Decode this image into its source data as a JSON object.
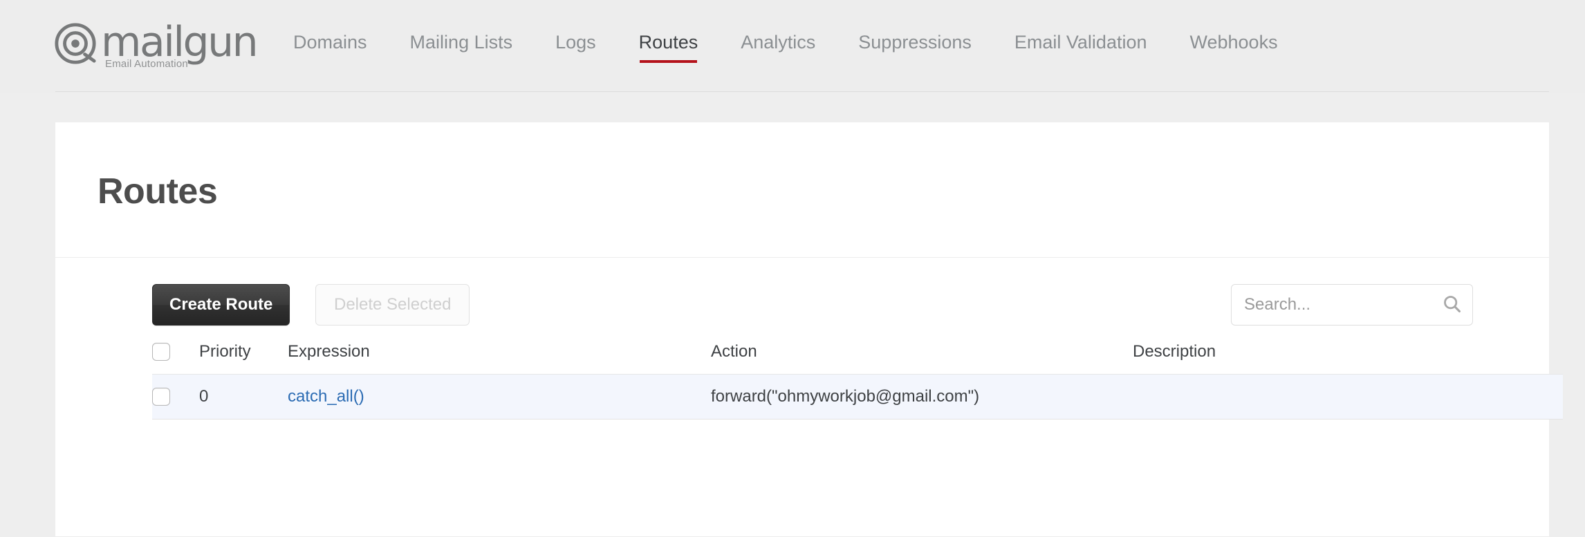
{
  "brand": {
    "word": "mailgun",
    "tagline": "Email Automation",
    "logo_icon": "at-sign-icon",
    "logo_color": "#77797a"
  },
  "nav": {
    "active": "Routes",
    "accent_color": "#b4121b",
    "items": [
      {
        "label": "Domains"
      },
      {
        "label": "Mailing Lists"
      },
      {
        "label": "Logs"
      },
      {
        "label": "Routes"
      },
      {
        "label": "Analytics"
      },
      {
        "label": "Suppressions"
      },
      {
        "label": "Email Validation"
      },
      {
        "label": "Webhooks"
      }
    ]
  },
  "page": {
    "title": "Routes"
  },
  "toolbar": {
    "create_label": "Create Route",
    "delete_label": "Delete Selected",
    "delete_disabled": true
  },
  "search": {
    "placeholder": "Search...",
    "value": "",
    "icon": "search-icon"
  },
  "table": {
    "columns": [
      {
        "key": "select",
        "label": ""
      },
      {
        "key": "priority",
        "label": "Priority"
      },
      {
        "key": "expression",
        "label": "Expression"
      },
      {
        "key": "action",
        "label": "Action"
      },
      {
        "key": "description",
        "label": "Description"
      }
    ],
    "select_all_checked": false,
    "rows": [
      {
        "selected": false,
        "priority": "0",
        "expression": "catch_all()",
        "action": "forward(\"ohmyworkjob@gmail.com\")",
        "description": ""
      }
    ],
    "link_color": "#2a6bb3",
    "row_highlight_color": "#f3f6fd"
  }
}
